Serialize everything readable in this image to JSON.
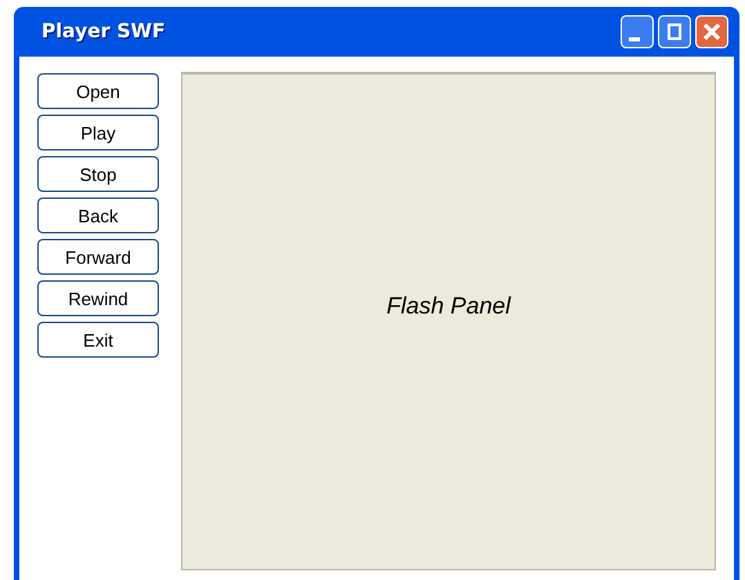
{
  "window": {
    "title": "Player SWF"
  },
  "buttons": [
    "Open",
    "Play",
    "Stop",
    "Back",
    "Forward",
    "Rewind",
    "Exit"
  ],
  "panel": {
    "label": "Flash Panel"
  }
}
